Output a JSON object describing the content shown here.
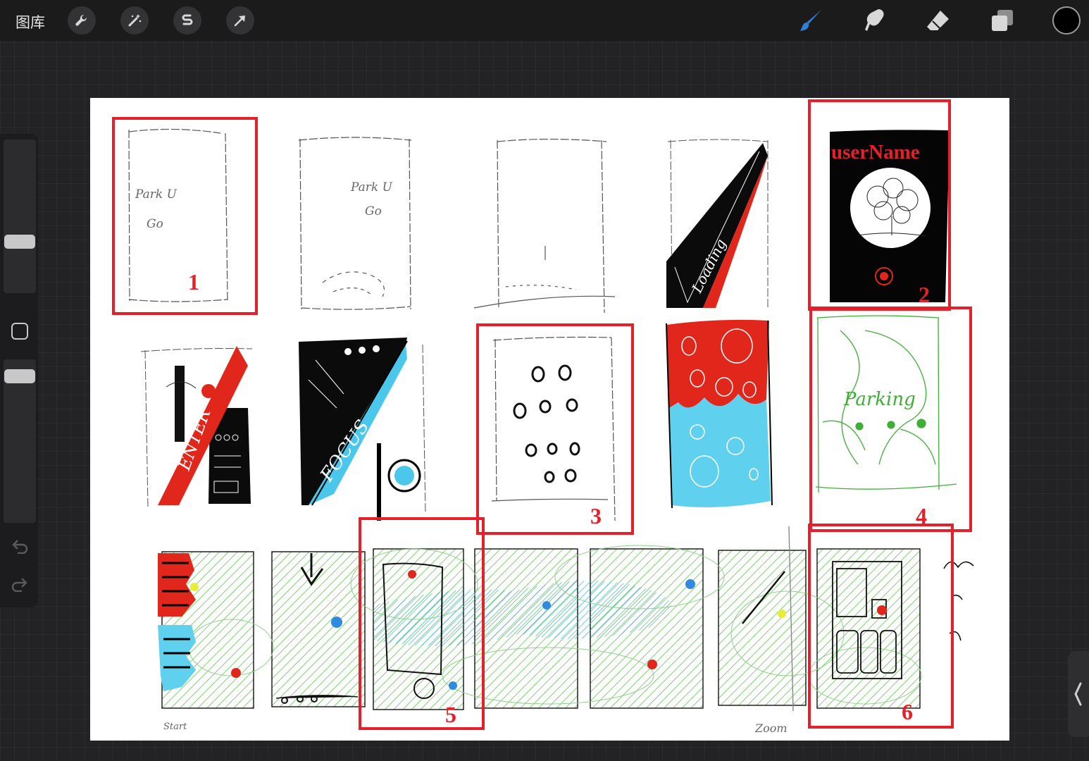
{
  "toolbar": {
    "gallery_label": "图库",
    "left_tools": [
      {
        "name": "actions",
        "icon": "wrench-icon"
      },
      {
        "name": "adjustments",
        "icon": "magic-wand-icon"
      },
      {
        "name": "selection",
        "icon": "selection-s-icon"
      },
      {
        "name": "transform",
        "icon": "arrow-cursor-icon"
      }
    ],
    "right_tools": [
      {
        "name": "brush",
        "icon": "brush-icon",
        "active": true
      },
      {
        "name": "smudge",
        "icon": "smudge-icon"
      },
      {
        "name": "eraser",
        "icon": "eraser-icon"
      },
      {
        "name": "layers",
        "icon": "layers-icon"
      }
    ],
    "accent_color": "#2f7fd6",
    "current_color": "#000000"
  },
  "sidebar": {
    "brush_size_icon": "slider-thumb",
    "modify_icon": "square-icon",
    "brush_opacity_icon": "slider-thumb",
    "undo_icon": "undo-icon",
    "redo_icon": "redo-icon"
  },
  "canvas": {
    "annotation_color": "#e5202a",
    "annotations": [
      "1",
      "2",
      "3",
      "4",
      "5",
      "6"
    ],
    "sketch_texts": {
      "park_title_1a": "Park U",
      "park_title_1b": "Go",
      "park_title_2a": "Park U",
      "park_title_2b": "Go",
      "loading": "Loading",
      "username": "userName",
      "enter": "ENTER",
      "focus": "FOCUS",
      "parking": "Parking",
      "start": "Start",
      "zoom": "Zoom"
    }
  }
}
